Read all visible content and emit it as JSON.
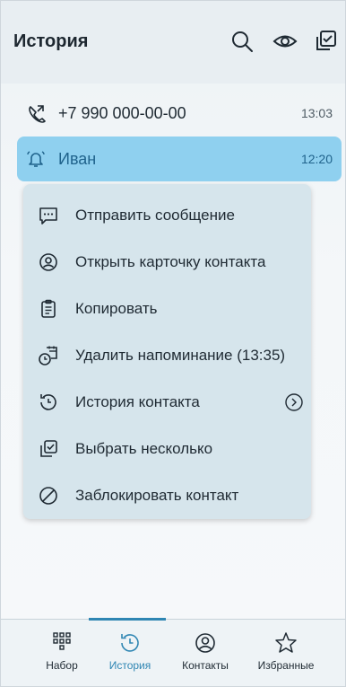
{
  "header": {
    "title": "История"
  },
  "calls": [
    {
      "name": "+7 990 000-00-00",
      "time": "13:03",
      "icon": "outgoing-call-icon"
    },
    {
      "name": "Иван",
      "time": "12:20",
      "icon": "reminder-bell-icon",
      "selected": true
    }
  ],
  "context_menu": {
    "items": [
      {
        "label": "Отправить сообщение",
        "icon": "message-icon"
      },
      {
        "label": "Открыть карточку контакта",
        "icon": "contact-card-icon"
      },
      {
        "label": "Копировать",
        "icon": "clipboard-icon"
      },
      {
        "label": "Удалить напоминание (13:35)",
        "icon": "delete-reminder-icon"
      },
      {
        "label": "История контакта",
        "icon": "history-icon",
        "has_submenu": true
      },
      {
        "label": "Выбрать несколько",
        "icon": "multi-select-icon"
      },
      {
        "label": "Заблокировать контакт",
        "icon": "block-icon"
      }
    ]
  },
  "bottom_nav": {
    "tabs": [
      {
        "label": "Набор",
        "icon": "dialpad-icon"
      },
      {
        "label": "История",
        "icon": "history-icon",
        "active": true
      },
      {
        "label": "Контакты",
        "icon": "contacts-icon"
      },
      {
        "label": "Избранные",
        "icon": "star-icon"
      }
    ]
  },
  "colors": {
    "accent": "#2f86b3",
    "selected_row": "#8fd0ef",
    "menu_bg": "#d6e5ec"
  }
}
